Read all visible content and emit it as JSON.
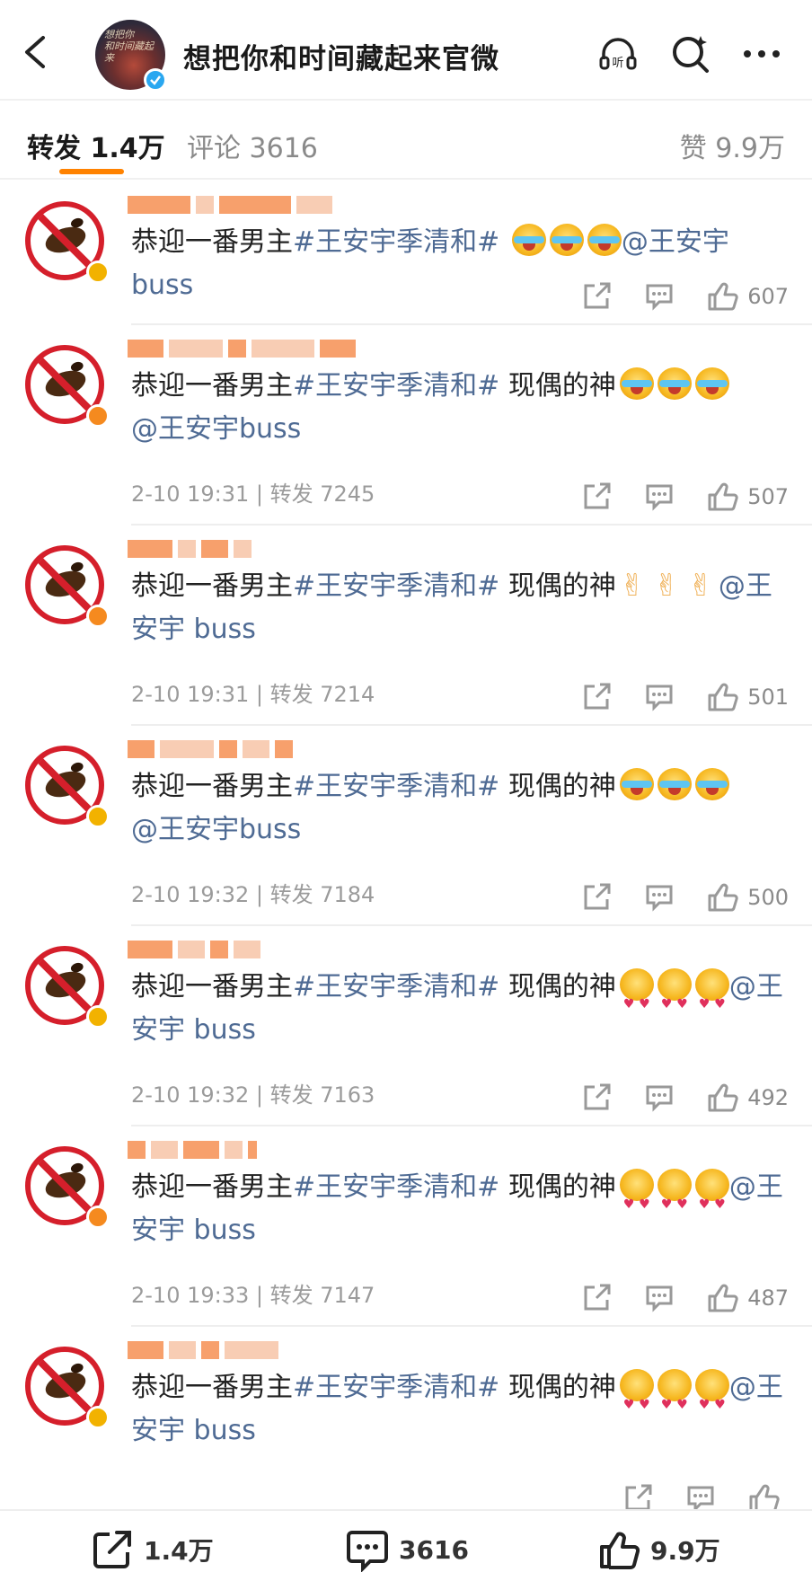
{
  "header": {
    "title": "想把你和时间藏起来官微"
  },
  "tabs": {
    "repost": "转发 1.4万",
    "comments": "评论 3616",
    "likes": "赞 9.9万"
  },
  "items": [
    {
      "topic": "#王安宇季清和#",
      "mention_line1": "@王安宇",
      "mention_line2": "buss",
      "lead": "恭迎一番男主",
      "mid": " ",
      "meta": "",
      "likes": "607",
      "emoji": "cry",
      "badge": "gold"
    },
    {
      "topic": "#王安宇季清和#",
      "mention_line1": "",
      "mention_line2": "@王安宇buss",
      "lead": "恭迎一番男主",
      "mid": " 现偶的神",
      "meta": "2-10 19:31 | 转发 7245",
      "likes": "507",
      "emoji": "cry",
      "badge": "orange"
    },
    {
      "topic": "#王安宇季清和#",
      "mention_line1": "@王",
      "mention_line2": "安宇 buss",
      "lead": "恭迎一番男主",
      "mid": " 现偶的神",
      "meta": "2-10 19:31 | 转发 7214",
      "likes": "501",
      "emoji": "peace",
      "badge": "orange"
    },
    {
      "topic": "#王安宇季清和#",
      "mention_line1": "",
      "mention_line2": "@王安宇buss",
      "lead": "恭迎一番男主",
      "mid": " 现偶的神",
      "meta": "2-10 19:32 | 转发 7184",
      "likes": "500",
      "emoji": "cry",
      "badge": "gold"
    },
    {
      "topic": "#王安宇季清和#",
      "mention_line1": "@王",
      "mention_line2": "安宇 buss",
      "lead": "恭迎一番男主",
      "mid": " 现偶的神",
      "meta": "2-10 19:32 | 转发 7163",
      "likes": "492",
      "emoji": "heart",
      "badge": "gold"
    },
    {
      "topic": "#王安宇季清和#",
      "mention_line1": "@王",
      "mention_line2": "安宇 buss",
      "lead": "恭迎一番男主",
      "mid": " 现偶的神",
      "meta": "2-10 19:33 | 转发 7147",
      "likes": "487",
      "emoji": "heart",
      "badge": "orange"
    },
    {
      "topic": "#王安宇季清和#",
      "mention_line1": "@王",
      "mention_line2": "安宇 buss",
      "lead": "恭迎一番男主",
      "mid": " 现偶的神",
      "meta": "",
      "likes": "",
      "emoji": "heart",
      "badge": "gold"
    }
  ],
  "bottom": {
    "repost": "1.4万",
    "comments": "3616",
    "likes": "9.9万"
  },
  "colors": {
    "accent": "#ff8200",
    "link": "#4f6b94",
    "verify_blue": "#2aa7f0",
    "verify_gold": "#f2b200"
  }
}
